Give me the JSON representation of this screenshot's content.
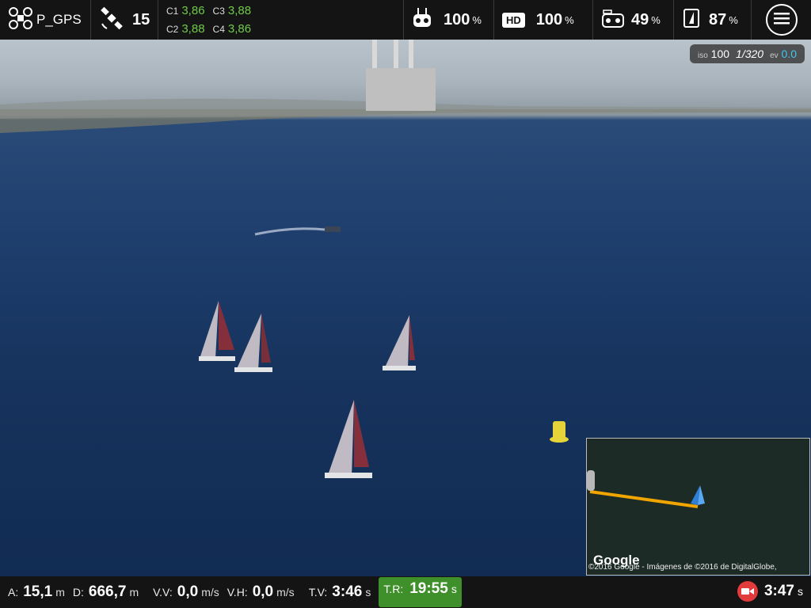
{
  "topbar": {
    "drone": {
      "name": "P_GPS"
    },
    "gps": {
      "satellites": "15"
    },
    "channels": [
      {
        "label": "C1",
        "value": "3,86"
      },
      {
        "label": "C3",
        "value": "3,88"
      },
      {
        "label": "C2",
        "value": "3,88"
      },
      {
        "label": "C4",
        "value": "3,86"
      }
    ],
    "rc_signal": {
      "value": "100",
      "unit": "%"
    },
    "hd_signal": {
      "label": "HD",
      "value": "100",
      "unit": "%"
    },
    "rc_battery": {
      "value": "49",
      "unit": "%"
    },
    "drone_battery": {
      "value": "87",
      "unit": "%"
    }
  },
  "camera": {
    "iso_label": "iso",
    "iso": "100",
    "shutter": "1/320",
    "ev_label": "ev",
    "ev": "0.0"
  },
  "minimap": {
    "logo": "Google",
    "copyright": "©2016 Google - Imágenes de ©2016 de DigitalGlobe,"
  },
  "telemetry": {
    "altitude": {
      "label": "A:",
      "value": "15,1",
      "unit": "m"
    },
    "distance": {
      "label": "D:",
      "value": "666,7",
      "unit": "m"
    },
    "vertical_speed": {
      "label": "V.V:",
      "value": "0,0",
      "unit": "m/s"
    },
    "horizontal_speed": {
      "label": "V.H:",
      "value": "0,0",
      "unit": "m/s"
    },
    "flight_time": {
      "label": "T.V:",
      "value": "3:46",
      "unit": "s"
    },
    "remaining_time": {
      "label": "T.R:",
      "value": "19:55",
      "unit": "s"
    },
    "recording_time": {
      "value": "3:47",
      "unit": "s"
    }
  },
  "colors": {
    "bar_bg": "#141414",
    "accent_green": "#6fca4a",
    "remaining_box": "#3f8f2a",
    "record_red": "#e23b3b",
    "ev_blue": "#3fc8f0"
  }
}
